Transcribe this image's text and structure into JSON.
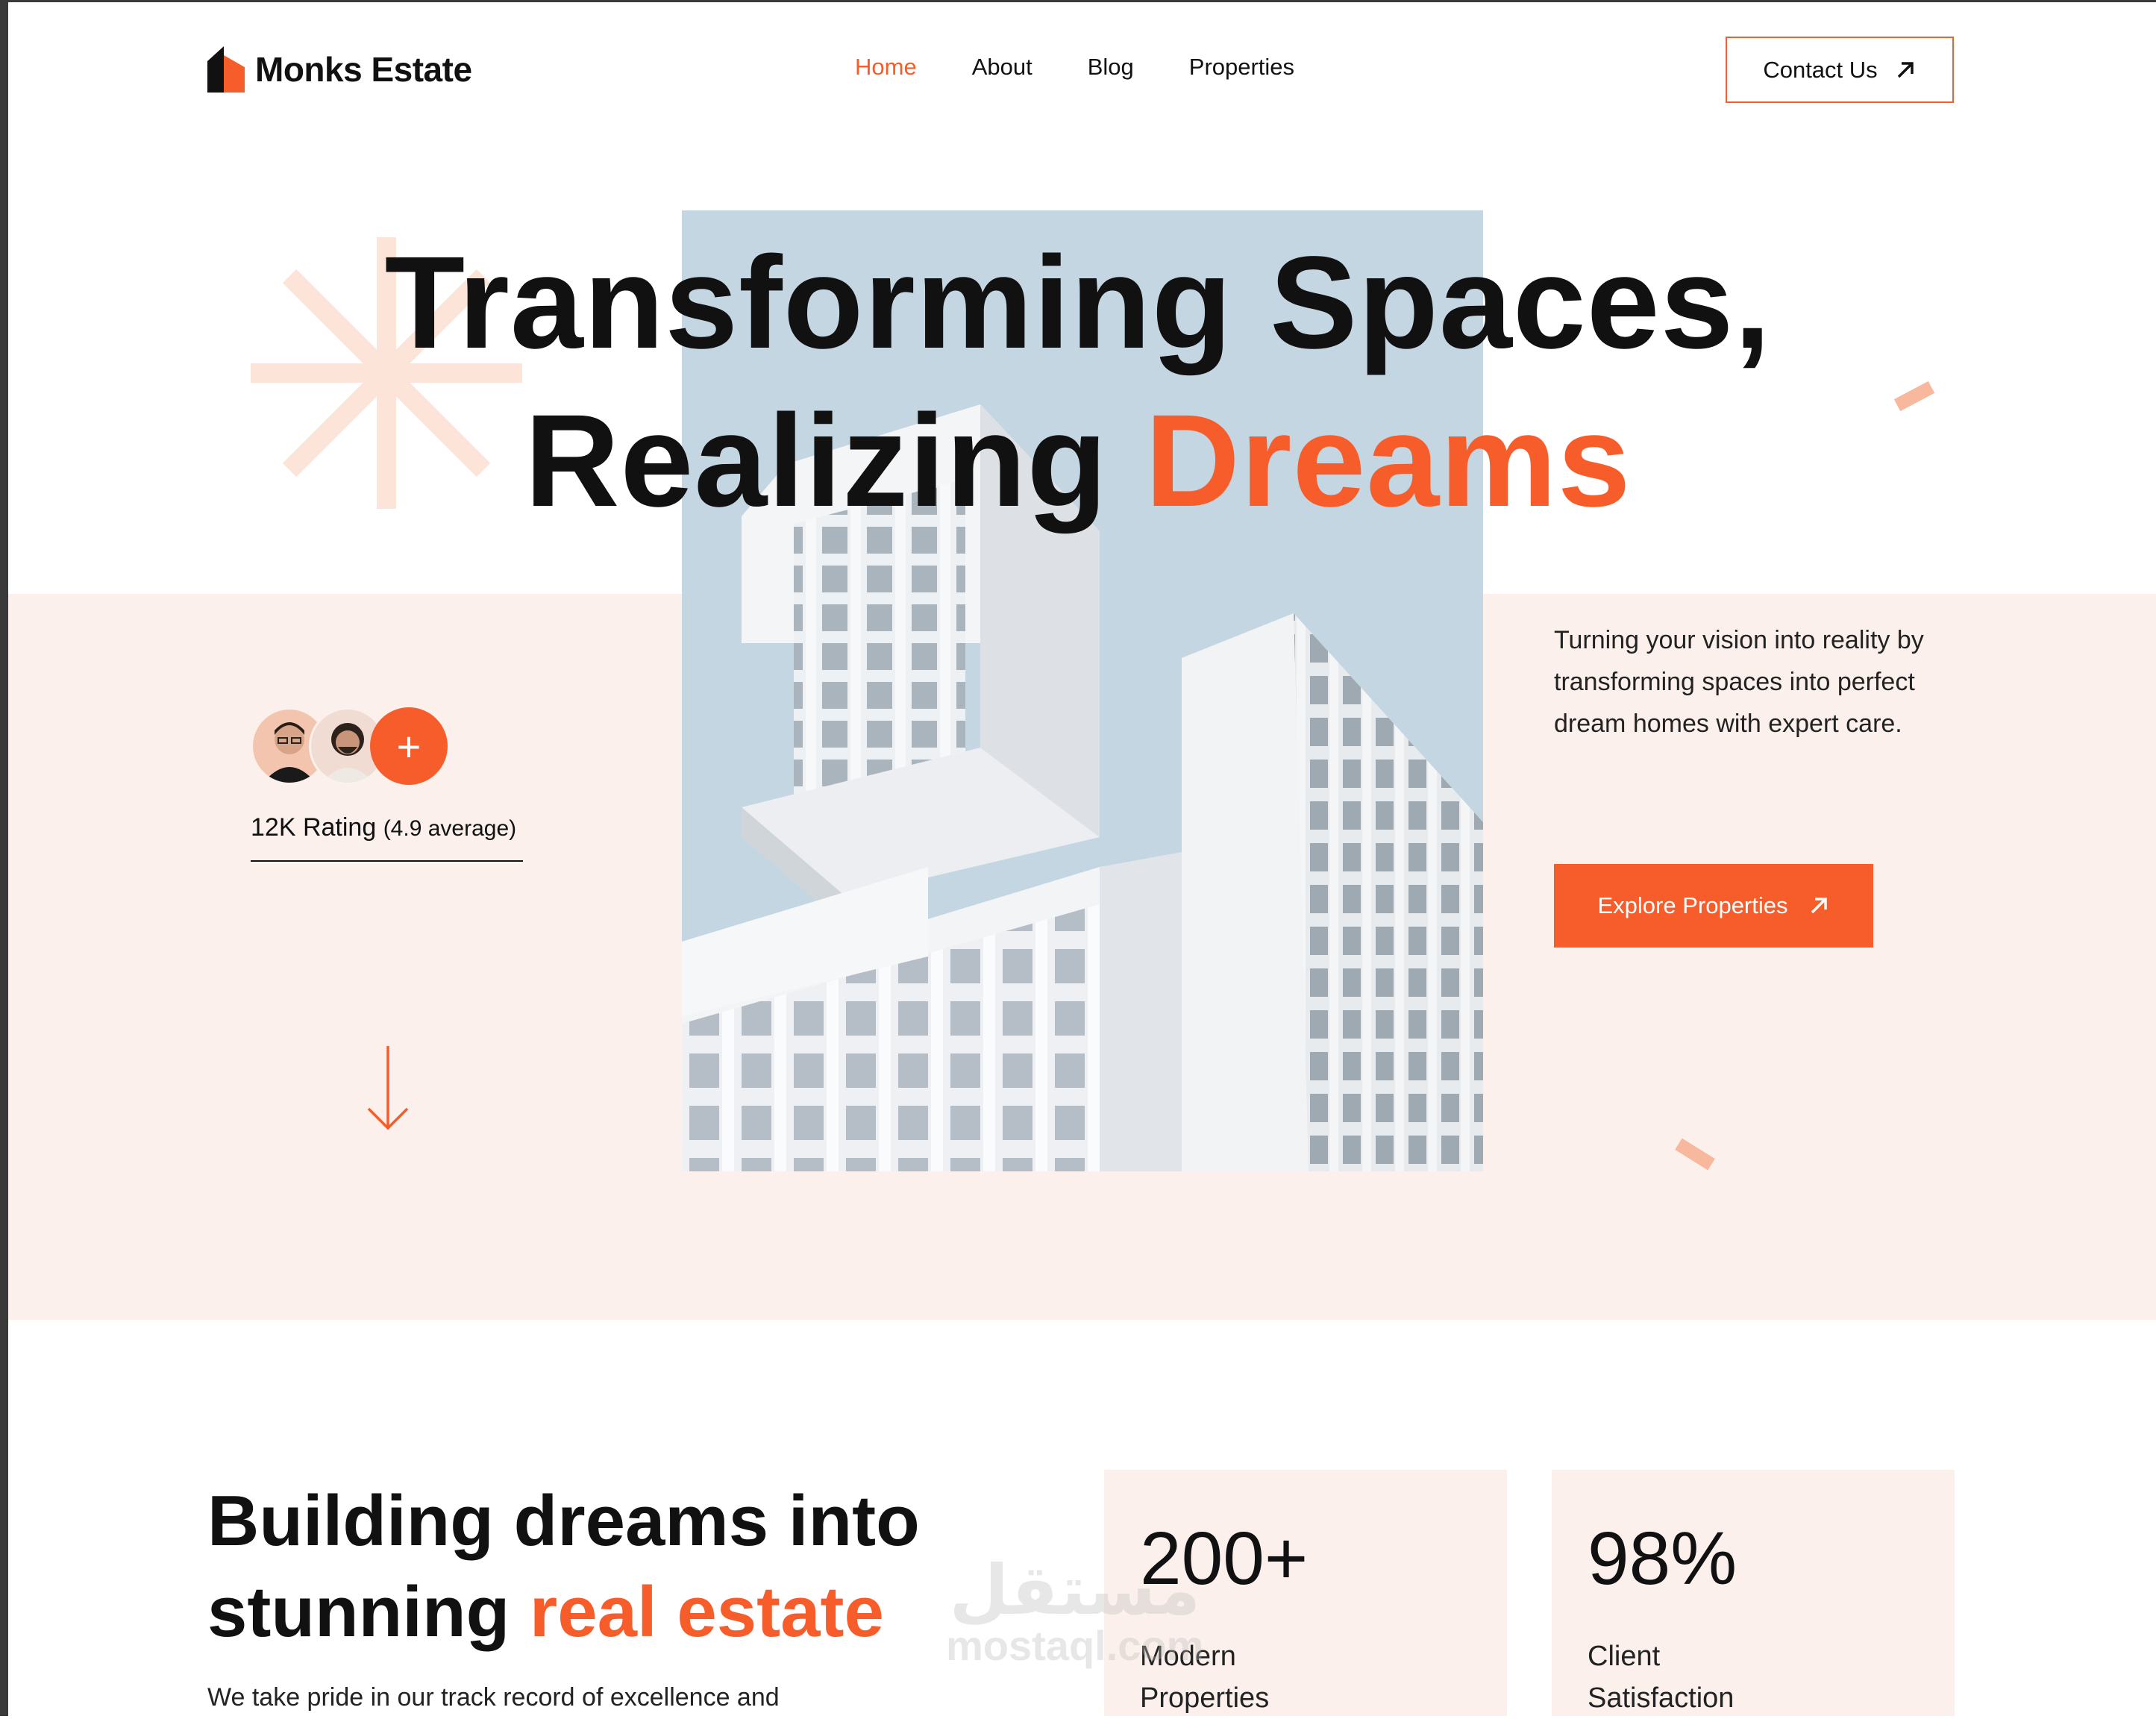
{
  "brand": {
    "name": "Monks Estate",
    "accent_color": "#f75d2b",
    "peach_color": "#fbf0eb"
  },
  "nav": {
    "items": [
      {
        "label": "Home",
        "active": true
      },
      {
        "label": "About",
        "active": false
      },
      {
        "label": "Blog",
        "active": false
      },
      {
        "label": "Properties",
        "active": false
      }
    ],
    "contact_label": "Contact Us",
    "contact_icon": "arrow-up-right-icon"
  },
  "hero": {
    "title_line1": "Transforming Spaces,",
    "title_line2_plain": "Realizing",
    "title_line2_accent": "Dreams",
    "description": "Turning your vision into reality by transforming spaces into perfect dream homes with expert care.",
    "cta_label": "Explore Properties",
    "cta_icon": "arrow-up-right-icon",
    "rating_main": "12K Rating",
    "rating_sub": "(4.9 average)",
    "plus_symbol": "+",
    "scroll_icon": "arrow-down-icon",
    "photo_icon": "building-photo"
  },
  "about": {
    "title_line1": "Building dreams into",
    "title_line2_plain": "stunning",
    "title_line2_accent": "real estate",
    "description": "We take pride in our track record of excellence and"
  },
  "stats": [
    {
      "value": "200+",
      "label": "Modern Properties"
    },
    {
      "value": "98%",
      "label": "Client Satisfaction"
    }
  ],
  "watermark": {
    "arabic": "مستقل",
    "latin": "mostaql.com"
  }
}
